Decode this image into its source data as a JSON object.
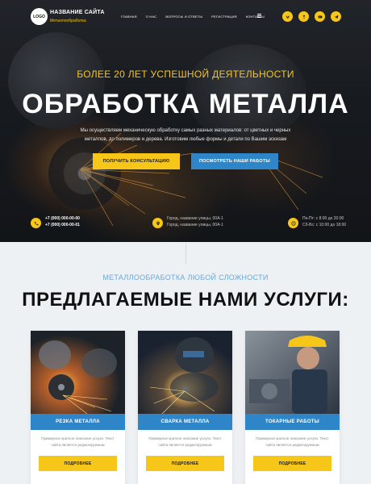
{
  "header": {
    "logo": "LOGO",
    "site_name": "НАЗВАНИЕ САЙТА",
    "site_subtitle": "Металлообработка",
    "nav": [
      "ГЛАВНАЯ",
      "О НАС",
      "ВОПРОСЫ И ОТВЕТЫ",
      "РЕГИСТРАЦИЯ",
      "КОНТАКТЫ"
    ],
    "menu_icon": "hamburger-icon",
    "social_icons": [
      "vk-icon",
      "odnoklassniki-icon",
      "youtube-icon",
      "telegram-icon"
    ]
  },
  "hero": {
    "tagline": "БОЛЕЕ 20 ЛЕТ УСПЕШНОЙ ДЕЯТЕЛЬНОСТИ",
    "headline": "ОБРАБОТКА МЕТАЛЛА",
    "description_line1": "Мы осуществляем механическую обработку самых разных материалов: от цветных и черных",
    "description_line2": "металлов, до полимеров и дерева. Изготовим любые формы и детали по Вашим эскизам",
    "btn_consult": "ПОЛУЧИТЬ КОНСУЛЬТАЦИЮ",
    "btn_works": "ПОСМОТРЕТЬ НАШИ РАБОТЫ"
  },
  "contacts": {
    "phone1": "+7 (000) 000-00-00",
    "phone2": "+7 (000) 000-00-01",
    "address1": "Город, название улицы, 00А-1",
    "address2": "Город, название улицы, 00А-1",
    "hours1": "Пн-Пт: с 8:00 до 20:00",
    "hours2": "Сб-Вс: с 10:00 до 18:00"
  },
  "services": {
    "subtitle": "МЕТАЛЛООБРАБОТКА ЛЮБОЙ СЛОЖНОСТИ",
    "title": "ПРЕДЛАГАЕМЫЕ НАМИ УСЛУГИ:",
    "cards": [
      {
        "title": "РЕЗКА МЕТАЛЛА",
        "text1": "Примерное краткое описание услуги. Текст",
        "text2": "сайта является редактируемым",
        "btn": "ПОДРОБНЕЕ"
      },
      {
        "title": "СВАРКА МЕТАЛЛА",
        "text1": "Примерное краткое описание услуги. Текст",
        "text2": "сайта является редактируемым",
        "btn": "ПОДРОБНЕЕ"
      },
      {
        "title": "ТОКАРНЫЕ РАБОТЫ",
        "text1": "Примерное краткое описание услуги. Текст",
        "text2": "сайта является редактируемым",
        "btn": "ПОДРОБНЕЕ"
      }
    ]
  },
  "colors": {
    "accent": "#f6c619",
    "blue": "#2e86c8",
    "light_blue": "#6aa8d8"
  }
}
